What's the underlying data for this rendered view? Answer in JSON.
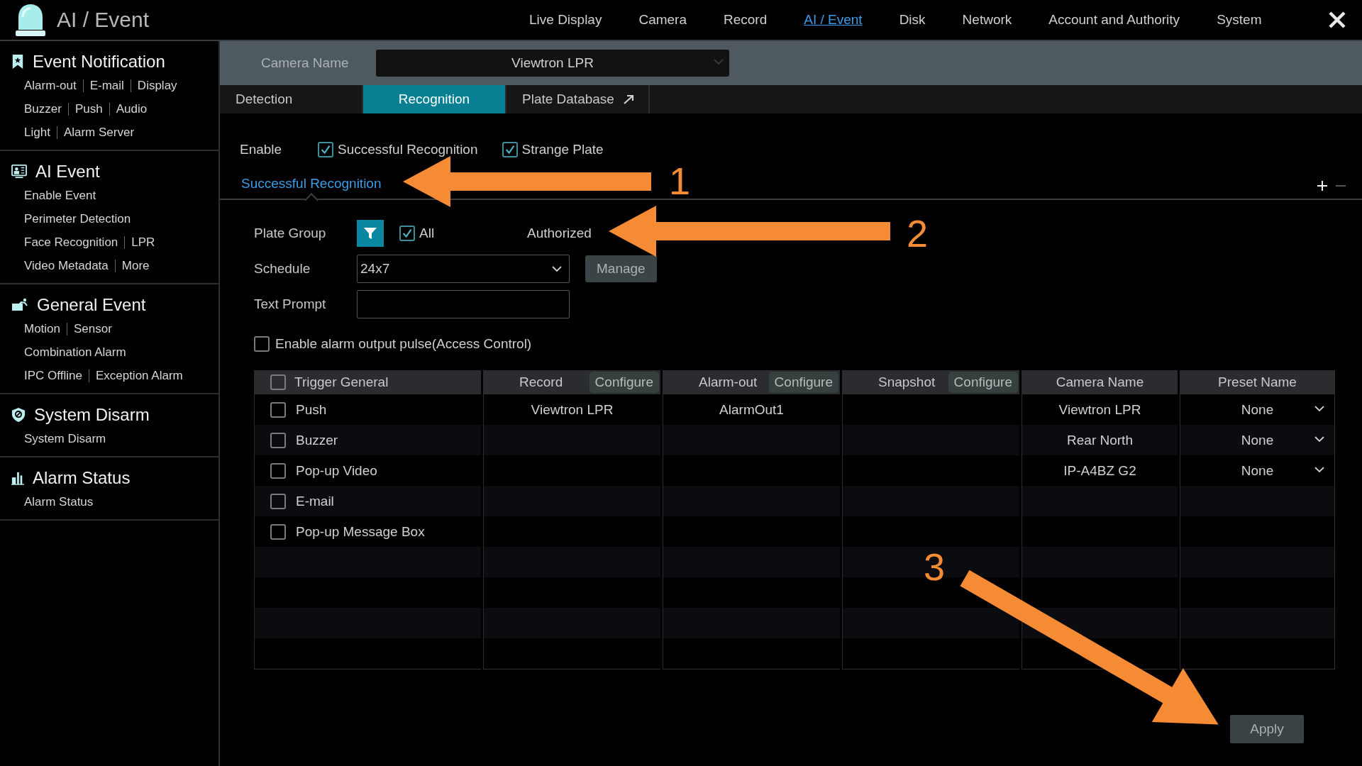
{
  "header": {
    "title": "AI / Event",
    "nav": [
      {
        "label": "Live Display",
        "selected": false
      },
      {
        "label": "Camera",
        "selected": false
      },
      {
        "label": "Record",
        "selected": false
      },
      {
        "label": "AI / Event",
        "selected": true
      },
      {
        "label": "Disk",
        "selected": false
      },
      {
        "label": "Network",
        "selected": false
      },
      {
        "label": "Account and Authority",
        "selected": false
      },
      {
        "label": "System",
        "selected": false
      }
    ]
  },
  "sidebar": [
    {
      "title": "Event Notification",
      "kind": "bookmark",
      "lines": [
        [
          "Alarm-out",
          "E-mail",
          "Display"
        ],
        [
          "Buzzer",
          "Push",
          "Audio"
        ],
        [
          "Light",
          "Alarm Server"
        ]
      ]
    },
    {
      "title": "AI Event",
      "kind": "ai",
      "lines": [
        [
          "Enable Event"
        ],
        [
          "Perimeter Detection"
        ],
        [
          "Face Recognition",
          "LPR"
        ],
        [
          "Video Metadata",
          "More"
        ]
      ]
    },
    {
      "title": "General Event",
      "kind": "general",
      "lines": [
        [
          "Motion",
          "Sensor"
        ],
        [
          "Combination Alarm"
        ],
        [
          "IPC Offline",
          "Exception Alarm"
        ]
      ]
    },
    {
      "title": "System Disarm",
      "kind": "shield",
      "lines": [
        [
          "System Disarm"
        ]
      ]
    },
    {
      "title": "Alarm Status",
      "kind": "chart",
      "lines": [
        [
          "Alarm Status"
        ]
      ]
    }
  ],
  "camera_bar": {
    "label": "Camera Name",
    "value": "Viewtron LPR"
  },
  "tabs": [
    {
      "label": "Detection",
      "selected": false,
      "external": false
    },
    {
      "label": "Recognition",
      "selected": true,
      "external": false
    },
    {
      "label": "Plate Database",
      "selected": false,
      "external": true
    }
  ],
  "enable": {
    "label": "Enable",
    "options": [
      {
        "label": "Successful Recognition",
        "checked": true
      },
      {
        "label": "Strange Plate",
        "checked": true
      }
    ]
  },
  "subtabs": [
    {
      "label": "Successful Recognition",
      "selected": true
    }
  ],
  "form": {
    "plate_group": {
      "label": "Plate Group",
      "all_label": "All",
      "all_checked": true,
      "value": "Authorized"
    },
    "schedule": {
      "label": "Schedule",
      "value": "24x7",
      "button": "Manage"
    },
    "text_prompt": {
      "label": "Text Prompt"
    },
    "pulse": {
      "label": "Enable alarm output pulse(Access Control)",
      "checked": false
    }
  },
  "table": {
    "trigger_header": {
      "label": "Trigger General",
      "checked": false
    },
    "columns": [
      {
        "label": "Record",
        "button": "Configure"
      },
      {
        "label": "Alarm-out",
        "button": "Configure"
      },
      {
        "label": "Snapshot",
        "button": "Configure"
      }
    ],
    "triggers": [
      {
        "label": "Push",
        "checked": false
      },
      {
        "label": "Buzzer",
        "checked": false
      },
      {
        "label": "Pop-up Video",
        "checked": false
      },
      {
        "label": "E-mail",
        "checked": false
      },
      {
        "label": "Pop-up Message Box",
        "checked": false
      }
    ],
    "column_values": [
      [
        "Viewtron LPR"
      ],
      [
        "AlarmOut1"
      ]
    ],
    "camera_header": "Camera Name",
    "preset_header": "Preset Name",
    "presets": [
      {
        "camera": "Viewtron LPR",
        "preset": "None"
      },
      {
        "camera": "Rear North",
        "preset": "None"
      },
      {
        "camera": "IP-A4BZ G2",
        "preset": "None"
      }
    ]
  },
  "apply": "Apply",
  "annotations": [
    {
      "number": "1"
    },
    {
      "number": "2"
    },
    {
      "number": "3"
    }
  ]
}
